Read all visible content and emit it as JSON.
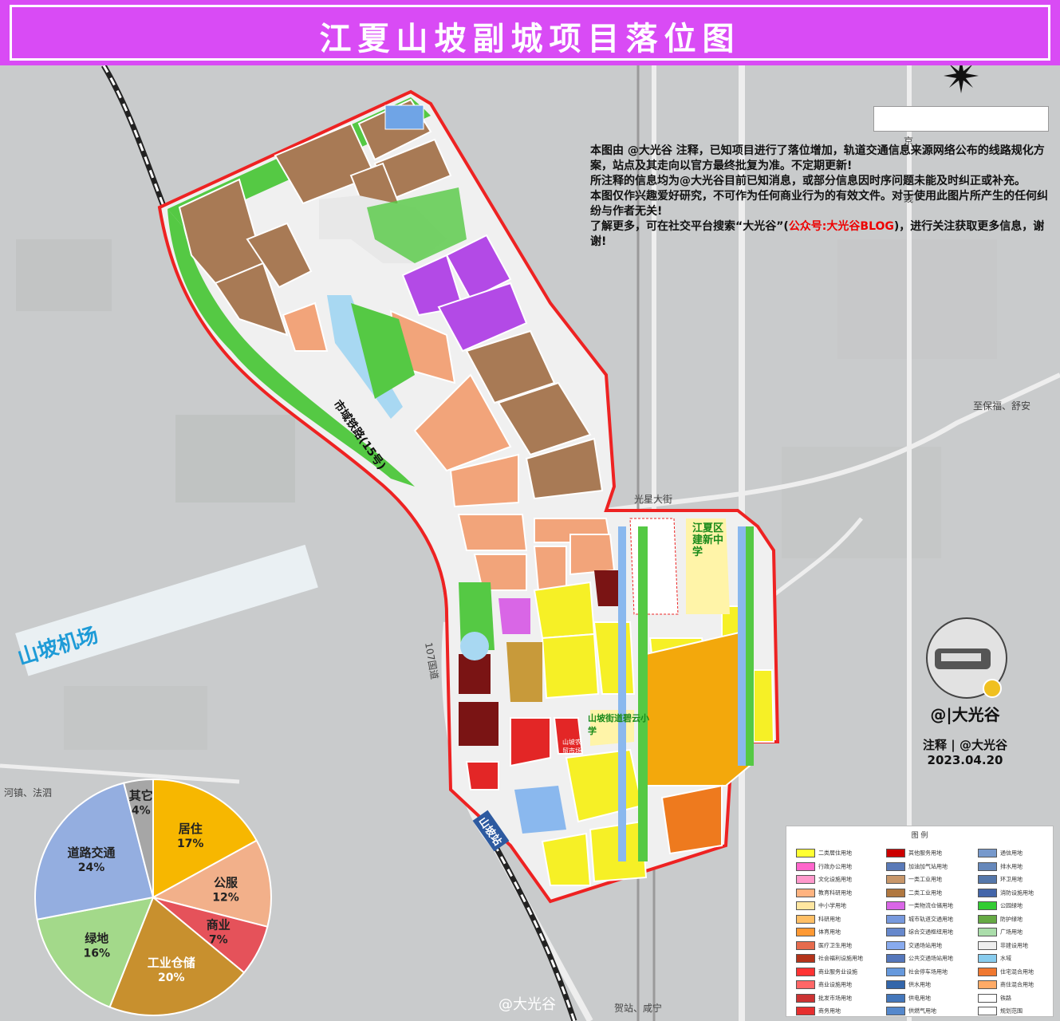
{
  "title": "江夏山坡副城项目落位图",
  "notes": {
    "line1": "本图由 @大光谷 注释，已知项目进行了落位增加，轨道交通信息来源网络公布的线路规化方案，站点及其走向以官方最终批复为准。不定期更新!",
    "line2": "所注释的信息均为@大光谷目前已知消息，或部分信息因时序问题未能及时纠正或补充。",
    "line3": "本图仅作兴趣爱好研究，不可作为任何商业行为的有效文件。对于使用此图片所产生的任何纠纷与作者无关!",
    "line4_a": "了解更多，可在社交平台搜索“大光谷”(",
    "line4_red": "公众号:大光谷BLOG",
    "line4_b": ")，进行关注获取更多信息，谢谢!"
  },
  "map_labels": {
    "airport": "山坡机场",
    "expressway": "市域铁路(15号)",
    "road_107": "107国道",
    "guangxing": "光星大街",
    "baoji": "至保福、舒安",
    "jing": "京",
    "line": "线",
    "fahe": "河镇、法泗",
    "xianning": "贺站、咸宁",
    "school1": "江夏区建新中学",
    "school2": "山坡街道碧云小学",
    "market": "山坡农贸市场",
    "station": "山坡站"
  },
  "signature": {
    "handle": "@|大光谷",
    "credit": "注释 | @大光谷",
    "date": "2023.04.20",
    "weibo": "@大光谷"
  },
  "pie": {
    "segments": [
      {
        "label": "居住",
        "pct": "17%",
        "value": 17,
        "color": "#f7b700"
      },
      {
        "label": "公服",
        "pct": "12%",
        "value": 12,
        "color": "#f2b08a"
      },
      {
        "label": "商业",
        "pct": "7%",
        "value": 7,
        "color": "#e5525a"
      },
      {
        "label": "工业仓储",
        "pct": "20%",
        "value": 20,
        "color": "#c8902e"
      },
      {
        "label": "绿地",
        "pct": "16%",
        "value": 16,
        "color": "#a3d98a"
      },
      {
        "label": "道路交通",
        "pct": "24%",
        "value": 24,
        "color": "#94aee0"
      },
      {
        "label": "其它",
        "pct": "4%",
        "value": 4,
        "color": "#a6a6a6"
      }
    ]
  },
  "legend": {
    "title": "图 例",
    "col1": [
      "二类居住用地",
      "行政办公用地",
      "文化设施用地",
      "教育科研用地",
      "中小学用地",
      "科研用地",
      "体育用地",
      "医疗卫生用地",
      "社会福利设施用地",
      "商业服务业设施",
      "商业设施用地",
      "批发市场用地",
      "商务用地"
    ],
    "col2": [
      "其他服务用地",
      "加油加气站用地",
      "一类工业用地",
      "二类工业用地",
      "一类物流仓储用地",
      "城市轨道交通用地",
      "综合交通枢纽用地",
      "交通场站用地",
      "公共交通场站用地",
      "社会停车场用地",
      "供水用地",
      "供电用地",
      "供燃气用地"
    ],
    "col3": [
      "通信用地",
      "排水用地",
      "环卫用地",
      "消防设施用地",
      "公园绿地",
      "防护绿地",
      "广场用地",
      "非建设用地",
      "水域",
      "住宅混合用地",
      "商住混合用地",
      "铁路",
      "规划范围"
    ],
    "colors1": [
      "#ffff33",
      "#ff66cc",
      "#ff99cc",
      "#ffb380",
      "#ffe6a0",
      "#ffbf66",
      "#ff9933",
      "#e66b4d",
      "#b3331a",
      "#ff3333",
      "#ff6666",
      "#cc3333",
      "#e62e2e"
    ],
    "colors2": [
      "#cc0000",
      "#5a7ab8",
      "#c8976a",
      "#b07840",
      "#d966e6",
      "#7799dd",
      "#6688cc",
      "#88aaee",
      "#5577bb",
      "#6699dd",
      "#3366aa",
      "#4477bb",
      "#5588cc"
    ],
    "colors3": [
      "#7799cc",
      "#6688bb",
      "#5577aa",
      "#4466aa",
      "#33cc33",
      "#66aa44",
      "#aaddaa",
      "#eeeeee",
      "#88ccee",
      "#f07830",
      "#ffaa66",
      "#ffffff",
      "#ffffff"
    ]
  }
}
